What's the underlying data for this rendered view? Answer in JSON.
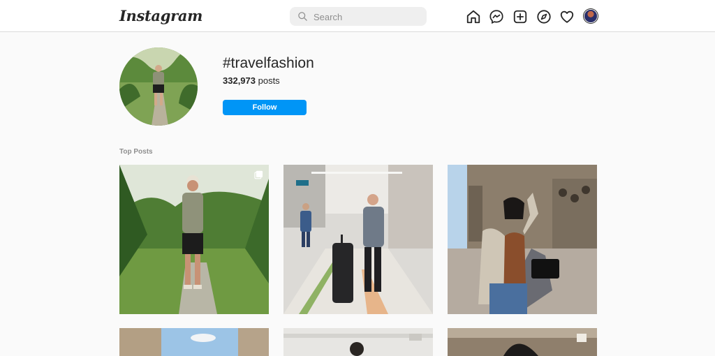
{
  "app": {
    "logo_text": "Instagram"
  },
  "search": {
    "placeholder": "Search"
  },
  "nav": {
    "icons": [
      "home-icon",
      "messenger-icon",
      "new-post-icon",
      "explore-icon",
      "activity-icon",
      "profile-avatar"
    ]
  },
  "hashtag": {
    "title": "#travelfashion",
    "post_count": "332,973",
    "post_count_suffix": " posts",
    "follow_label": "Follow"
  },
  "sections": {
    "top_posts_label": "Top Posts"
  },
  "colors": {
    "accent": "#0095f6",
    "background": "#fafafa",
    "text": "#262626",
    "muted": "#8e8e8e"
  }
}
